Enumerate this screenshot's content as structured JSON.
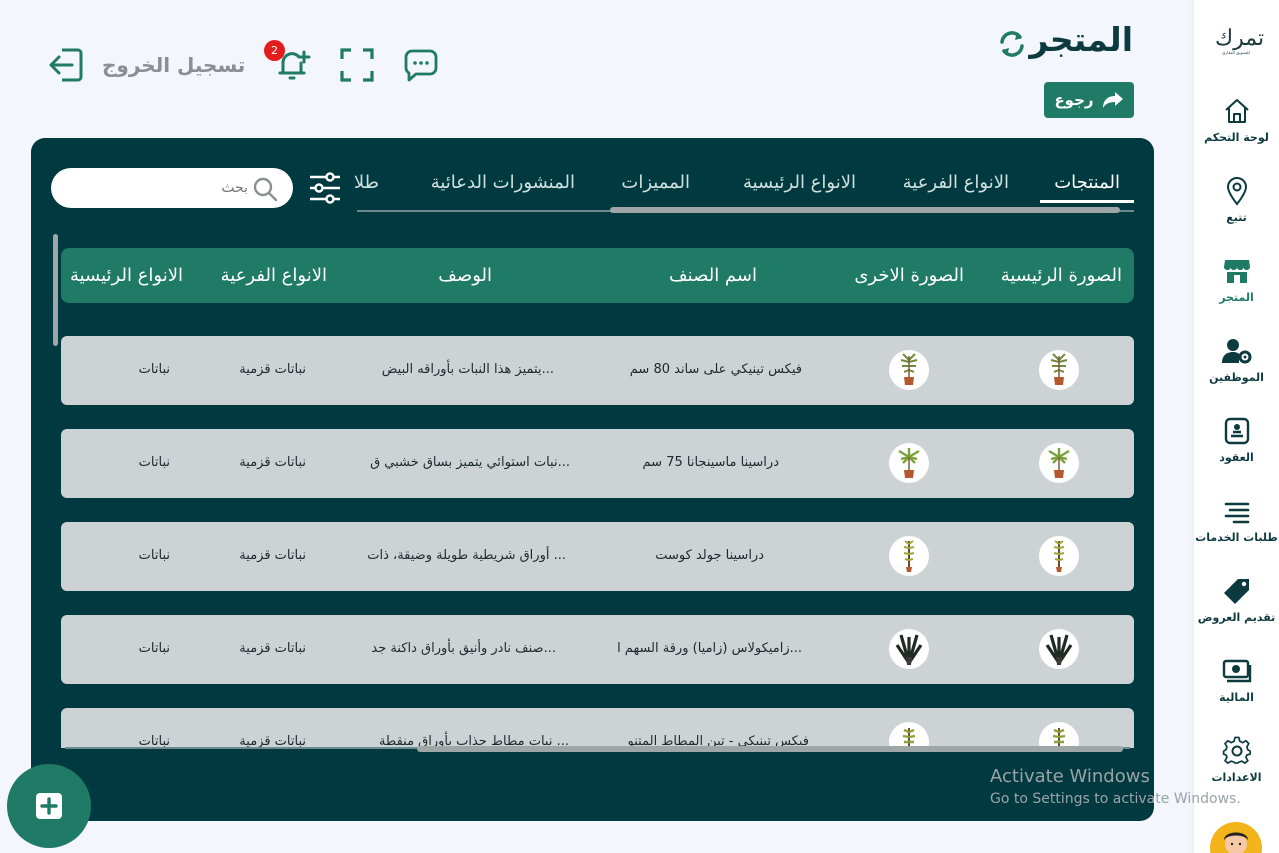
{
  "sidebar": {
    "logo_text": "تمرك",
    "logo_sub": "للتسويق العقاري",
    "items": [
      {
        "label": "لوحة التحكم",
        "icon": "home-icon"
      },
      {
        "label": "تتبع",
        "icon": "location-pin-icon"
      },
      {
        "label": "المتجر",
        "icon": "store-icon"
      },
      {
        "label": "الموظفين",
        "icon": "user-gear-icon"
      },
      {
        "label": "العقود",
        "icon": "contract-icon"
      },
      {
        "label": "طلبات الخدمات",
        "icon": "service-requests-icon"
      },
      {
        "label": "تقديم العروض",
        "icon": "tag-icon"
      },
      {
        "label": "المالية",
        "icon": "money-icon"
      },
      {
        "label": "الاعدادات",
        "icon": "settings-icon"
      }
    ]
  },
  "header": {
    "title": "المتجر",
    "back_label": "رجوع",
    "logout_label": "تسجيل الخروج",
    "notification_count": "2"
  },
  "tabs": [
    {
      "label": "المنتجات",
      "active": true
    },
    {
      "label": "الانواع الفرعية",
      "active": false
    },
    {
      "label": "الانواع الرئيسية",
      "active": false
    },
    {
      "label": "المميزات",
      "active": false
    },
    {
      "label": "المنشورات الدعائية",
      "active": false
    },
    {
      "label": "طلا",
      "active": false
    }
  ],
  "search": {
    "placeholder": "بحث"
  },
  "table": {
    "columns": [
      "الصورة الرئيسية",
      "الصورة الاخرى",
      "اسم الصنف",
      "الوصف",
      "الانواع الفرعية",
      "الانواع الرئيسية"
    ],
    "rows": [
      {
        "name": "فيكس تينيكي على ساند 80 سم",
        "description": "يتميز هذا النبات بأوراقه البيض...",
        "subtype": "نباتات قزمية",
        "maintype": "نباتات"
      },
      {
        "name": "دراسينا ماسينجانا 75 سم",
        "description": "نبات استوائي يتميز بساق خشبي ق...",
        "subtype": "نباتات قزمية",
        "maintype": "نباتات"
      },
      {
        "name": "دراسينا جولد كوست",
        "description": "أوراق شريطية طويلة وضيقة، ذات ...",
        "subtype": "نباتات قزمية",
        "maintype": "نباتات"
      },
      {
        "name": "زاميكولاس (زاميا) ورقة السهم ا...",
        "description": "صنف نادر وأنيق بأوراق داكنة جد...",
        "subtype": "نباتات قزمية",
        "maintype": "نباتات"
      },
      {
        "name": "فيكس تينيكي - تين المطاط المتنو",
        "description": "نبات مطاط جذاب بأوراق منقطة ...",
        "subtype": "نباتات قزمية",
        "maintype": "نباتات"
      }
    ]
  },
  "watermark": {
    "line1": "Activate Windows",
    "line2": "Go to Settings to activate Windows."
  },
  "colors": {
    "primary": "#1f7a66",
    "panel": "#003a40",
    "dark_text": "#0d3a3f",
    "badge": "#e31d1d"
  }
}
